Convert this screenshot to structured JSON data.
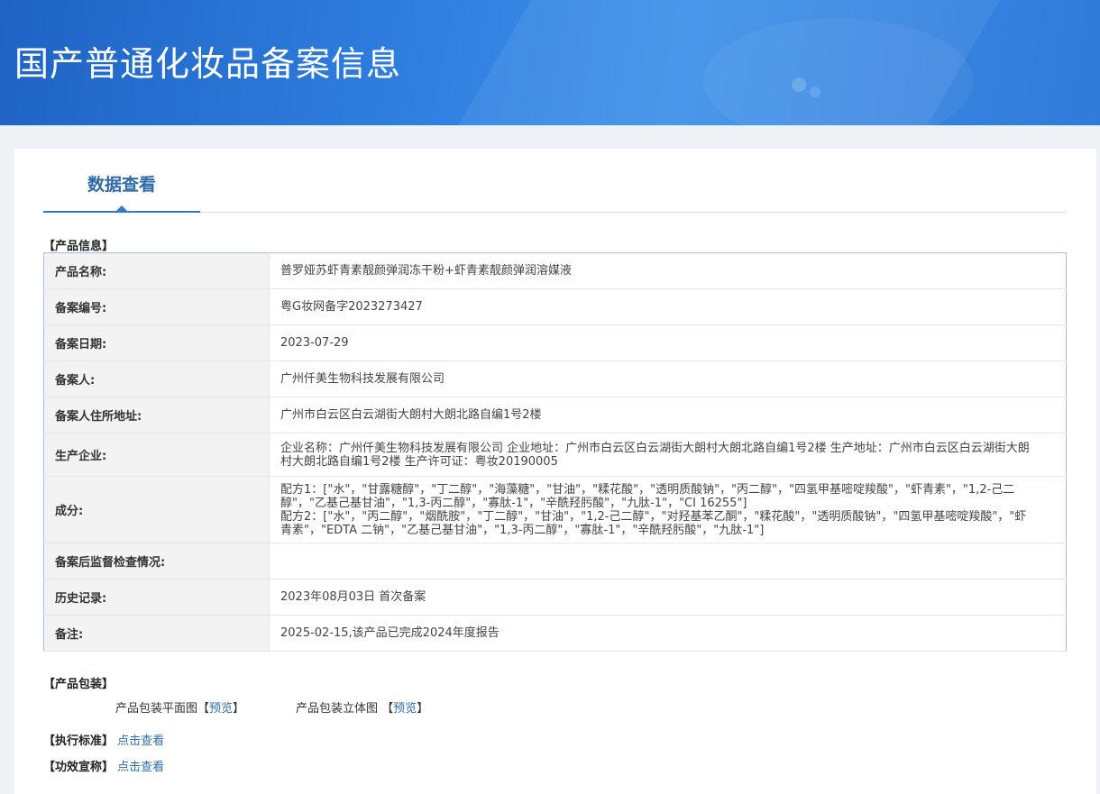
{
  "header": {
    "title": "国产普通化妆品备案信息"
  },
  "tabs": [
    {
      "label": "数据查看"
    }
  ],
  "product_info": {
    "section_label": "【产品信息】",
    "rows": [
      {
        "key": "产品名称:",
        "value": "普罗娅苏虾青素靓颜弹润冻干粉+虾青素靓颜弹润溶媒液"
      },
      {
        "key": "备案编号:",
        "value": "粤G妆网备字2023273427"
      },
      {
        "key": "备案日期:",
        "value": "2023-07-29"
      },
      {
        "key": "备案人:",
        "value": "广州仟美生物科技发展有限公司"
      },
      {
        "key": "备案人住所地址:",
        "value": "广州市白云区白云湖街大朗村大朗北路自编1号2楼"
      },
      {
        "key": "生产企业:",
        "value": "企业名称：广州仟美生物科技发展有限公司 企业地址：广州市白云区白云湖街大朗村大朗北路自编1号2楼 生产地址：广州市白云区白云湖街大朗村大朗北路自编1号2楼 生产许可证：粤妆20190005"
      },
      {
        "key": "成分:",
        "value_lines": [
          "配方1：[\"水\"，\"甘露糖醇\"，\"丁二醇\"，\"海藻糖\"，\"甘油\"，\"糅花酸\"，\"透明质酸钠\"，\"丙二醇\"，\"四氢甲基嘧啶羧酸\"，\"虾青素\"，\"1,2-己二醇\"，\"乙基己基甘油\"，\"1,3-丙二醇\"，\"寡肽-1\"，\"辛酰羟肟酸\"，\"九肽-1\"，\"CI 16255\"]",
          "配方2：[\"水\"，\"丙二醇\"，\"烟酰胺\"，\"丁二醇\"，\"甘油\"，\"1,2-己二醇\"，\"对羟基苯乙酮\"，\"糅花酸\"，\"透明质酸钠\"，\"四氢甲基嘧啶羧酸\"，\"虾青素\"，\"EDTA 二钠\"，\"乙基己基甘油\"，\"1,3-丙二醇\"，\"寡肽-1\"，\"辛酰羟肟酸\"，\"九肽-1\"]"
        ]
      },
      {
        "key": "备案后监督检查情况:",
        "value": ""
      },
      {
        "key": "历史记录:",
        "value": "2023年08月03日 首次备案"
      },
      {
        "key": "备注:",
        "value": "2025-02-15,该产品已完成2024年度报告"
      }
    ]
  },
  "packaging": {
    "section_label": "【产品包装】",
    "flat": {
      "label": "产品包装平面图",
      "bracket_open": "【",
      "link": "预览",
      "bracket_close": "】"
    },
    "stereo": {
      "label": "产品包装立体图",
      "bracket_open": "【",
      "link": "预览",
      "bracket_close": "】"
    }
  },
  "standard": {
    "label": "【执行标准】",
    "link": "点击查看"
  },
  "efficacy": {
    "label": "【功效宣称】",
    "link": "点击查看"
  }
}
